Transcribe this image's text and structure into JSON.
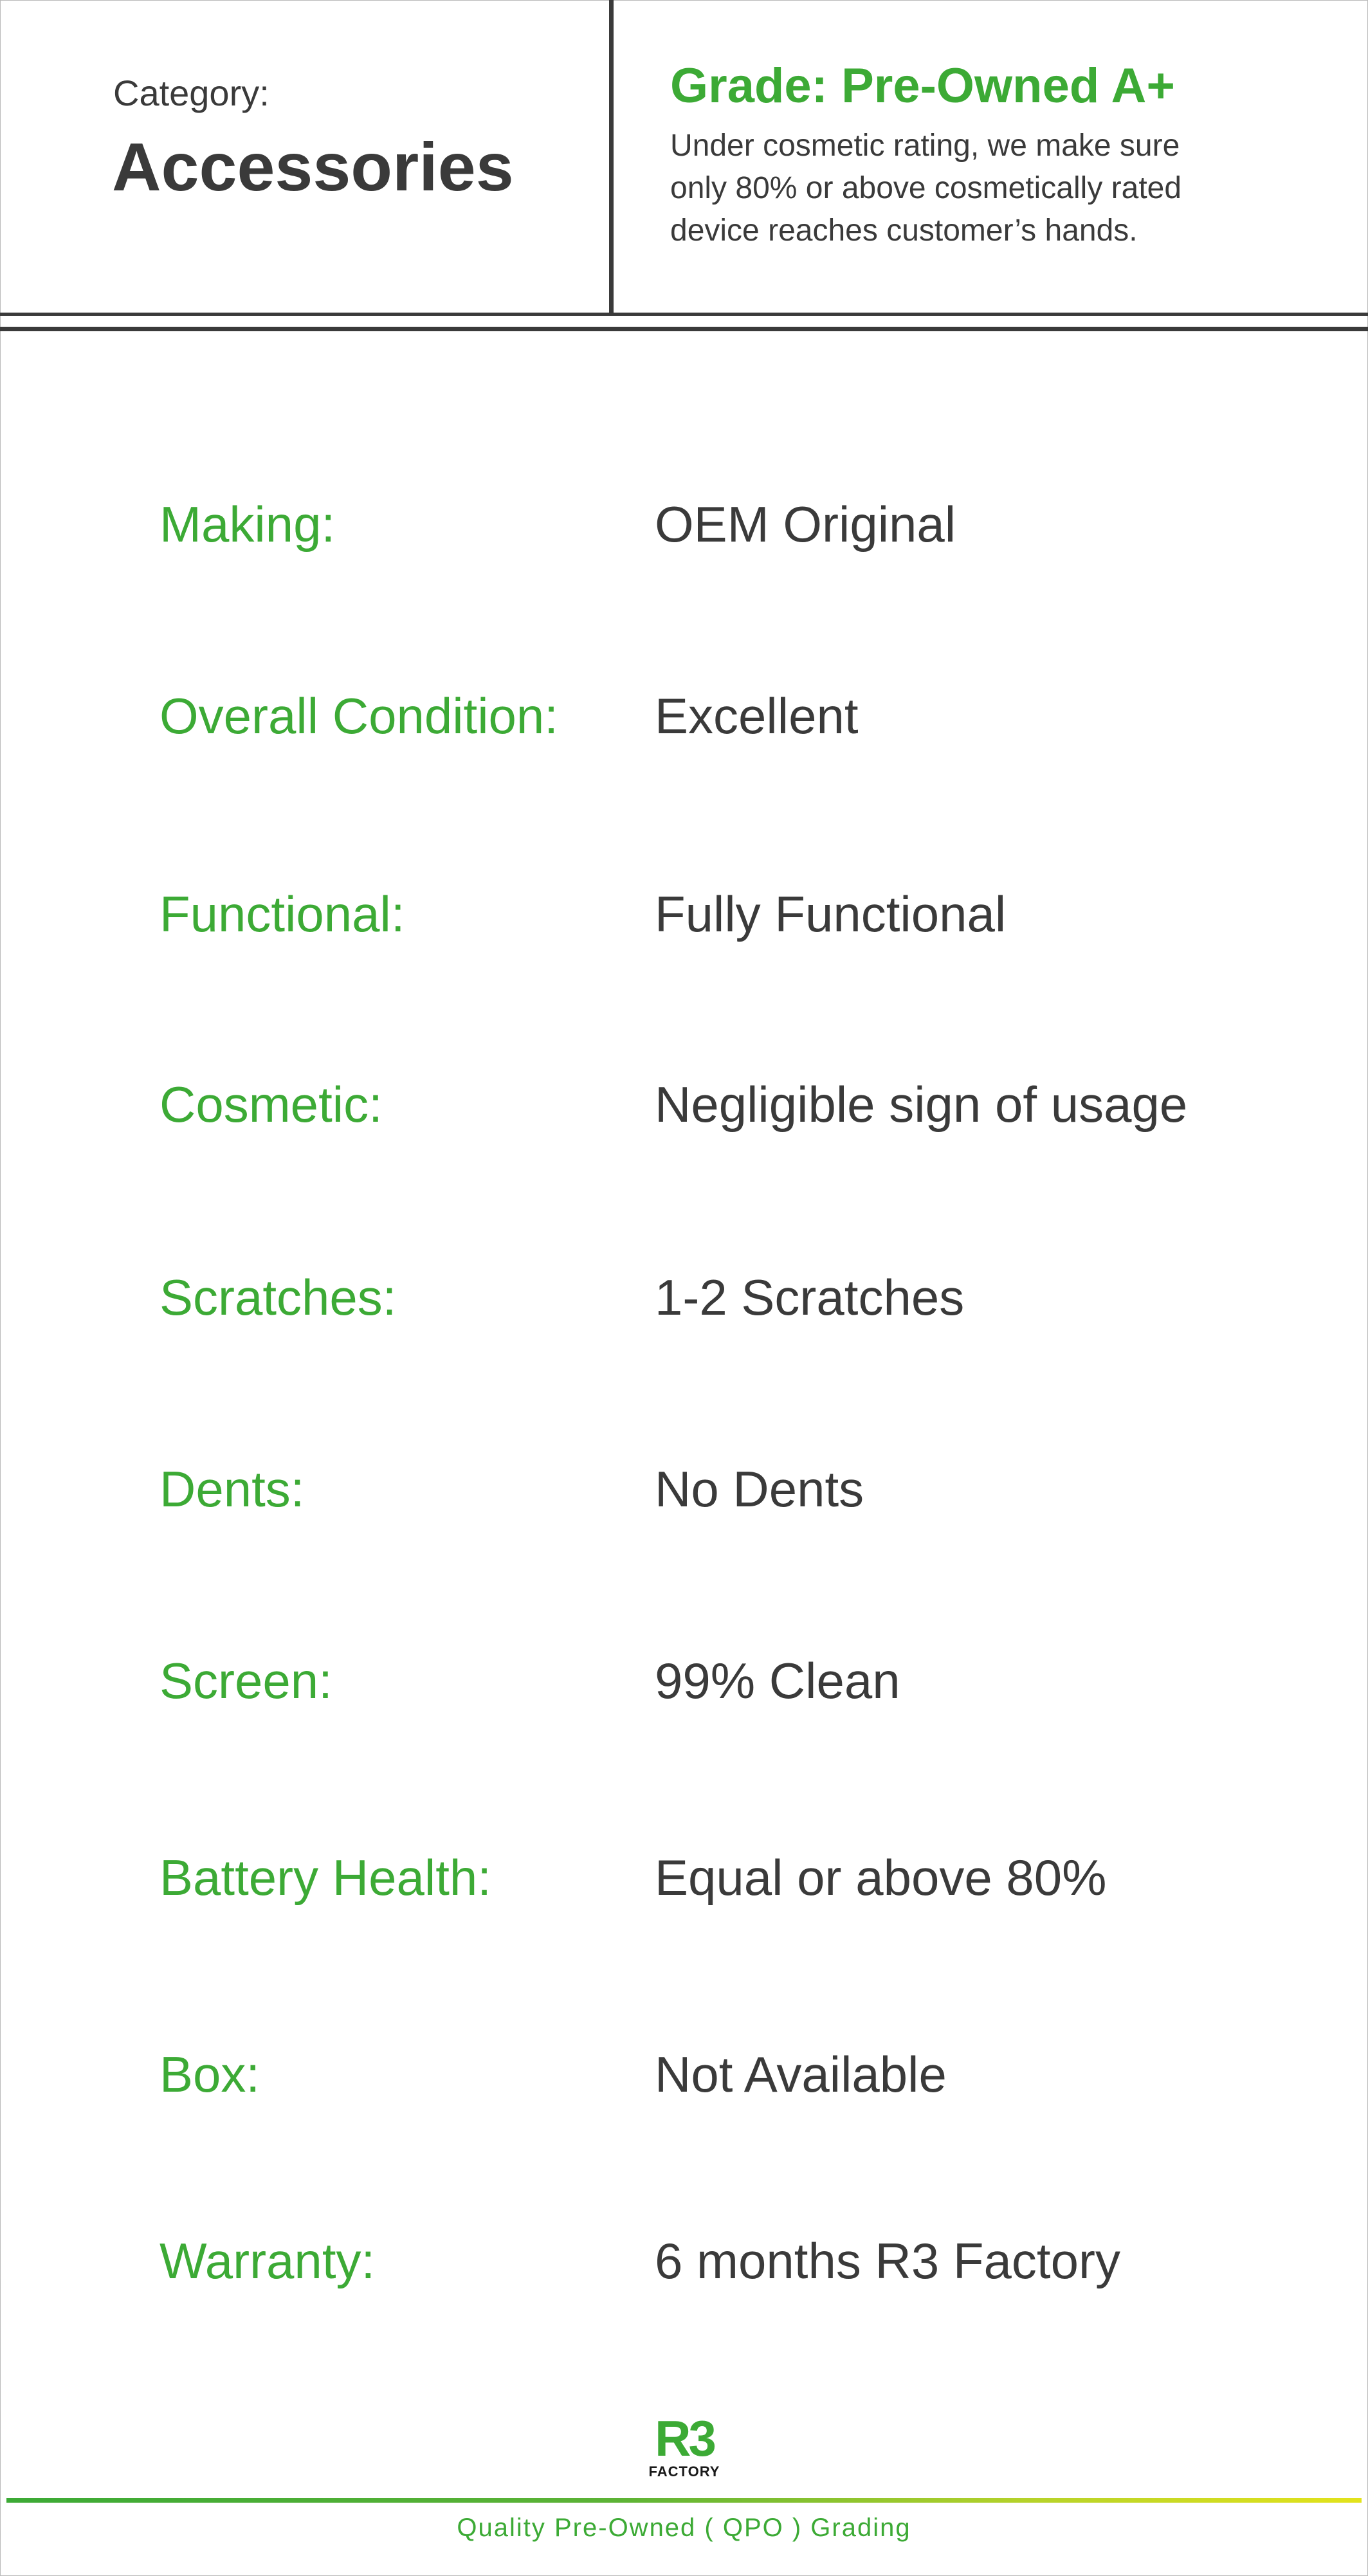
{
  "header": {
    "category_label": "Category:",
    "category_value": "Accessories",
    "grade_title": "Grade: Pre-Owned A+",
    "grade_description_lines": [
      "Under cosmetic rating, we make sure",
      "only 80% or above cosmetically rated",
      "device reaches customer’s hands."
    ]
  },
  "specs": [
    {
      "label": "Making:",
      "value": "OEM Original"
    },
    {
      "label": "Overall Condition:",
      "value": "Excellent"
    },
    {
      "label": "Functional:",
      "value": "Fully Functional"
    },
    {
      "label": "Cosmetic:",
      "value": "Negligible sign of usage"
    },
    {
      "label": "Scratches:",
      "value": "1-2 Scratches"
    },
    {
      "label": "Dents:",
      "value": "No Dents"
    },
    {
      "label": "Screen:",
      "value": "99% Clean"
    },
    {
      "label": "Battery Health:",
      "value": "Equal or above 80%"
    },
    {
      "label": "Box:",
      "value": "Not Available"
    },
    {
      "label": "Warranty:",
      "value": "6 months R3 Factory"
    }
  ],
  "footer": {
    "logo_mark": "R3",
    "logo_word": "FACTORY",
    "tagline": "Quality Pre-Owned ( QPO ) Grading"
  },
  "colors": {
    "accent_green": "#3caa35",
    "text_dark": "#3a3a3a",
    "gradient_end_yellow": "#e3e31c"
  }
}
